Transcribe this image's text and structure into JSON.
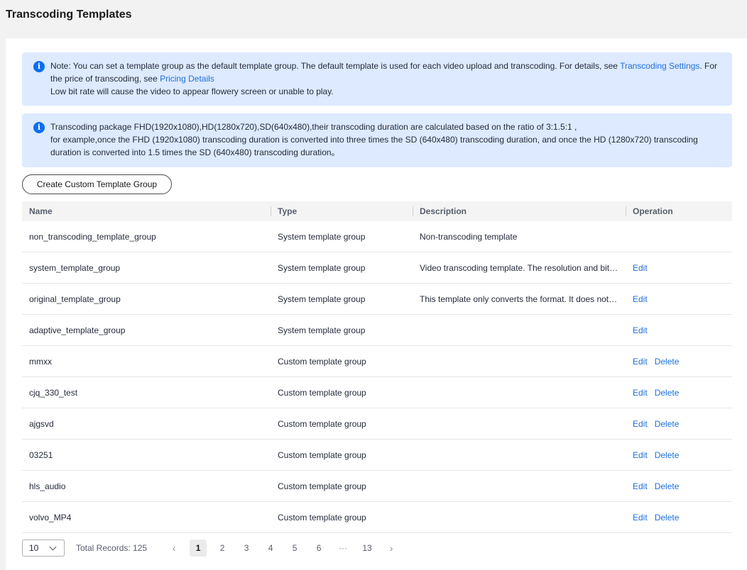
{
  "page": {
    "title": "Transcoding Templates"
  },
  "notices": {
    "n1": {
      "text_a": "Note: You can set a template group as the default template group. The default template is used for each video upload and transcoding. For details, see ",
      "link_a": "Transcoding Settings",
      "text_b": ". For the price of transcoding, see ",
      "link_b": "Pricing Details",
      "line2": "Low bit rate will cause the video to appear flowery screen or unable to play."
    },
    "n2": {
      "line1": "Transcoding package FHD(1920x1080),HD(1280x720),SD(640x480),their transcoding duration are calculated based on the ratio of 3:1.5:1 ,",
      "line2": "for example,once the FHD (1920x1080) transcoding duration is converted into three times the SD (640x480) transcoding duration, and once the HD (1280x720) transcoding duration is converted into 1.5 times the SD (640x480) transcoding duration。"
    }
  },
  "actions": {
    "create_label": "Create Custom Template Group"
  },
  "table": {
    "headers": {
      "name": "Name",
      "type": "Type",
      "description": "Description",
      "operation": "Operation"
    },
    "rows": [
      {
        "name": "non_transcoding_template_group",
        "type": "System template group",
        "description": "Non-transcoding template",
        "edit": "",
        "delete": ""
      },
      {
        "name": "system_template_group",
        "type": "System template group",
        "description": "Video transcoding template. The resolution and bit rate are adjusted based on the source video.",
        "edit": "Edit",
        "delete": ""
      },
      {
        "name": "original_template_group",
        "type": "System template group",
        "description": "This template only converts the format. It does not change the resolution.",
        "edit": "Edit",
        "delete": ""
      },
      {
        "name": "adaptive_template_group",
        "type": "System template group",
        "description": "",
        "edit": "Edit",
        "delete": ""
      },
      {
        "name": "mmxx",
        "type": "Custom template group",
        "description": "",
        "edit": "Edit",
        "delete": "Delete"
      },
      {
        "name": "cjq_330_test",
        "type": "Custom template group",
        "description": "",
        "edit": "Edit",
        "delete": "Delete"
      },
      {
        "name": "ajgsvd",
        "type": "Custom template group",
        "description": "",
        "edit": "Edit",
        "delete": "Delete"
      },
      {
        "name": "03251",
        "type": "Custom template group",
        "description": "",
        "edit": "Edit",
        "delete": "Delete"
      },
      {
        "name": "hls_audio",
        "type": "Custom template group",
        "description": "",
        "edit": "Edit",
        "delete": "Delete"
      },
      {
        "name": "volvo_MP4",
        "type": "Custom template group",
        "description": "",
        "edit": "Edit",
        "delete": "Delete"
      }
    ]
  },
  "pagination": {
    "page_size": "10",
    "total_label": "Total Records: 125",
    "pages": [
      "1",
      "2",
      "3",
      "4",
      "5",
      "6"
    ],
    "ellipsis": "···",
    "last_page": "13",
    "current": "1"
  }
}
